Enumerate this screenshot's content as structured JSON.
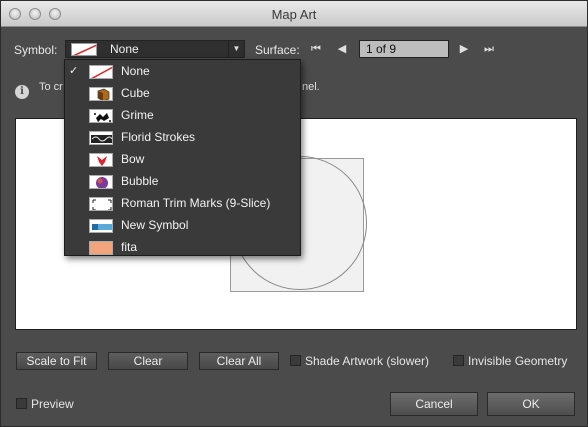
{
  "window": {
    "title": "Map Art"
  },
  "toolbar": {
    "symbol_label": "Symbol:",
    "symbol_value": "None",
    "surface_label": "Surface:",
    "surface_value": "1 of 9"
  },
  "info": {
    "text_left": "To cr",
    "text_right": "nel."
  },
  "symbol_menu": {
    "items": [
      {
        "label": "None",
        "selected": true,
        "thumb": "none-slash"
      },
      {
        "label": "Cube",
        "selected": false,
        "thumb": "cube"
      },
      {
        "label": "Grime",
        "selected": false,
        "thumb": "grime"
      },
      {
        "label": "Florid Strokes",
        "selected": false,
        "thumb": "florid-strokes"
      },
      {
        "label": "Bow",
        "selected": false,
        "thumb": "bow"
      },
      {
        "label": "Bubble",
        "selected": false,
        "thumb": "bubble"
      },
      {
        "label": "Roman Trim Marks (9-Slice)",
        "selected": false,
        "thumb": "trim-marks"
      },
      {
        "label": "New Symbol",
        "selected": false,
        "thumb": "new-symbol"
      },
      {
        "label": "fita",
        "selected": false,
        "thumb": "fita"
      }
    ],
    "checkmark": "✓"
  },
  "buttons": {
    "scale_to_fit": "Scale to Fit",
    "clear": "Clear",
    "clear_all": "Clear All",
    "cancel": "Cancel",
    "ok": "OK"
  },
  "options": {
    "shade_artwork": "Shade Artwork (slower)",
    "invisible_geometry": "Invisible Geometry",
    "preview": "Preview"
  },
  "colors": {
    "panel": "#4b4b4b",
    "menu": "#3a3a3a",
    "canvas": "#ffffff"
  }
}
